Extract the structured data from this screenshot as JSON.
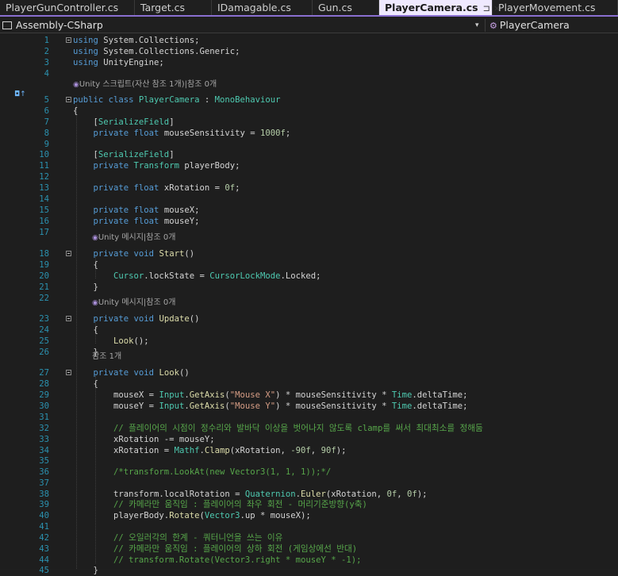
{
  "tabs": [
    {
      "label": "PlayerGunController.cs",
      "active": false
    },
    {
      "label": "Target.cs",
      "active": false
    },
    {
      "label": "IDamagable.cs",
      "active": false
    },
    {
      "label": "Gun.cs",
      "active": false
    },
    {
      "label": "PlayerCamera.cs",
      "active": true,
      "pin": "⊐",
      "close": "×"
    },
    {
      "label": "PlayerMovement.cs",
      "active": false
    }
  ],
  "nav": {
    "project": "Assembly-CSharp",
    "class": "PlayerCamera",
    "dropdown_glyph": "▾"
  },
  "lenses": {
    "class": "Unity 스크립트(자산 참조 1개)|참조 0개",
    "start": "Unity 메시지|참조 0개",
    "update": "Unity 메시지|참조 0개",
    "look": "참조 1개"
  },
  "lines": [
    {
      "n": "1",
      "tokens": [
        [
          "kw",
          "using"
        ],
        [
          "pl",
          " System.Collections;"
        ]
      ]
    },
    {
      "n": "2",
      "tokens": [
        [
          "kw",
          "using"
        ],
        [
          "pl",
          " System.Collections.Generic;"
        ]
      ]
    },
    {
      "n": "3",
      "tokens": [
        [
          "kw",
          "using"
        ],
        [
          "pl",
          " UnityEngine;"
        ]
      ]
    },
    {
      "n": "4",
      "tokens": []
    },
    {
      "n": "5",
      "tokens": [
        [
          "kw",
          "public class "
        ],
        [
          "ty",
          "PlayerCamera"
        ],
        [
          "pl",
          " : "
        ],
        [
          "ty",
          "MonoBehaviour"
        ]
      ]
    },
    {
      "n": "6",
      "tokens": [
        [
          "pl",
          "{"
        ]
      ]
    },
    {
      "n": "7",
      "tokens": [
        [
          "pl",
          "    ["
        ],
        [
          "ty",
          "SerializeField"
        ],
        [
          "pl",
          "]"
        ]
      ]
    },
    {
      "n": "8",
      "tokens": [
        [
          "kw",
          "    private float"
        ],
        [
          "pl",
          " mouseSensitivity = "
        ],
        [
          "nm",
          "1000f"
        ],
        [
          "pl",
          ";"
        ]
      ]
    },
    {
      "n": "9",
      "tokens": []
    },
    {
      "n": "10",
      "tokens": [
        [
          "pl",
          "    ["
        ],
        [
          "ty",
          "SerializeField"
        ],
        [
          "pl",
          "]"
        ]
      ]
    },
    {
      "n": "11",
      "tokens": [
        [
          "kw",
          "    private "
        ],
        [
          "ty",
          "Transform"
        ],
        [
          "pl",
          " playerBody;"
        ]
      ]
    },
    {
      "n": "12",
      "tokens": []
    },
    {
      "n": "13",
      "tokens": [
        [
          "kw",
          "    private float"
        ],
        [
          "pl",
          " xRotation = "
        ],
        [
          "nm",
          "0f"
        ],
        [
          "pl",
          ";"
        ]
      ]
    },
    {
      "n": "14",
      "tokens": []
    },
    {
      "n": "15",
      "tokens": [
        [
          "kw",
          "    private float"
        ],
        [
          "pl",
          " mouseX;"
        ]
      ]
    },
    {
      "n": "16",
      "tokens": [
        [
          "kw",
          "    private float"
        ],
        [
          "pl",
          " mouseY;"
        ]
      ]
    },
    {
      "n": "17",
      "tokens": []
    },
    {
      "n": "18",
      "tokens": [
        [
          "kw",
          "    private void "
        ],
        [
          "fn",
          "Start"
        ],
        [
          "pl",
          "()"
        ]
      ]
    },
    {
      "n": "19",
      "tokens": [
        [
          "pl",
          "    {"
        ]
      ]
    },
    {
      "n": "20",
      "tokens": [
        [
          "ty",
          "        Cursor"
        ],
        [
          "pl",
          ".lockState = "
        ],
        [
          "ty",
          "CursorLockMode"
        ],
        [
          "pl",
          ".Locked;"
        ]
      ]
    },
    {
      "n": "21",
      "tokens": [
        [
          "pl",
          "    }"
        ]
      ]
    },
    {
      "n": "22",
      "tokens": []
    },
    {
      "n": "23",
      "tokens": [
        [
          "kw",
          "    private void "
        ],
        [
          "fn",
          "Update"
        ],
        [
          "pl",
          "()"
        ]
      ]
    },
    {
      "n": "24",
      "tokens": [
        [
          "pl",
          "    {"
        ]
      ]
    },
    {
      "n": "25",
      "tokens": [
        [
          "fn",
          "        Look"
        ],
        [
          "pl",
          "();"
        ]
      ]
    },
    {
      "n": "26",
      "tokens": [
        [
          "pl",
          "    }"
        ]
      ]
    },
    {
      "n": "27",
      "tokens": [
        [
          "kw",
          "    private void "
        ],
        [
          "fn",
          "Look"
        ],
        [
          "pl",
          "()"
        ]
      ]
    },
    {
      "n": "28",
      "tokens": [
        [
          "pl",
          "    {"
        ]
      ]
    },
    {
      "n": "29",
      "tokens": [
        [
          "pl",
          "        mouseX = "
        ],
        [
          "ty",
          "Input"
        ],
        [
          "pl",
          "."
        ],
        [
          "fn",
          "GetAxis"
        ],
        [
          "pl",
          "("
        ],
        [
          "st",
          "\"Mouse X\""
        ],
        [
          "pl",
          ") * mouseSensitivity * "
        ],
        [
          "ty",
          "Time"
        ],
        [
          "pl",
          ".deltaTime;"
        ]
      ]
    },
    {
      "n": "30",
      "tokens": [
        [
          "pl",
          "        mouseY = "
        ],
        [
          "ty",
          "Input"
        ],
        [
          "pl",
          "."
        ],
        [
          "fn",
          "GetAxis"
        ],
        [
          "pl",
          "("
        ],
        [
          "st",
          "\"Mouse Y\""
        ],
        [
          "pl",
          ") * mouseSensitivity * "
        ],
        [
          "ty",
          "Time"
        ],
        [
          "pl",
          ".deltaTime;"
        ]
      ]
    },
    {
      "n": "31",
      "tokens": []
    },
    {
      "n": "32",
      "tokens": [
        [
          "cm",
          "        // 플레이어의 시점이 정수리와 발바닥 이상을 벗어나지 않도록 clamp를 써서 최대최소를 정해둠"
        ]
      ]
    },
    {
      "n": "33",
      "tokens": [
        [
          "pl",
          "        xRotation -= mouseY;"
        ]
      ]
    },
    {
      "n": "34",
      "tokens": [
        [
          "pl",
          "        xRotation = "
        ],
        [
          "ty",
          "Mathf"
        ],
        [
          "pl",
          "."
        ],
        [
          "fn",
          "Clamp"
        ],
        [
          "pl",
          "(xRotation, "
        ],
        [
          "nm",
          "-90f"
        ],
        [
          "pl",
          ", "
        ],
        [
          "nm",
          "90f"
        ],
        [
          "pl",
          ");"
        ]
      ]
    },
    {
      "n": "35",
      "tokens": []
    },
    {
      "n": "36",
      "tokens": [
        [
          "cm",
          "        /*transform.LookAt(new Vector3(1, 1, 1));*/"
        ]
      ]
    },
    {
      "n": "37",
      "tokens": []
    },
    {
      "n": "38",
      "tokens": [
        [
          "pl",
          "        transform.localRotation = "
        ],
        [
          "ty",
          "Quaternion"
        ],
        [
          "pl",
          "."
        ],
        [
          "fn",
          "Euler"
        ],
        [
          "pl",
          "(xRotation, "
        ],
        [
          "nm",
          "0f"
        ],
        [
          "pl",
          ", "
        ],
        [
          "nm",
          "0f"
        ],
        [
          "pl",
          ");"
        ]
      ]
    },
    {
      "n": "39",
      "tokens": [
        [
          "cm",
          "        // 카메라만 움직임 : 플레이어의 좌우 회전 - 머리기준방향(y축)"
        ]
      ]
    },
    {
      "n": "40",
      "tokens": [
        [
          "pl",
          "        playerBody."
        ],
        [
          "fn",
          "Rotate"
        ],
        [
          "pl",
          "("
        ],
        [
          "ty",
          "Vector3"
        ],
        [
          "pl",
          ".up * mouseX);"
        ]
      ]
    },
    {
      "n": "41",
      "tokens": []
    },
    {
      "n": "42",
      "tokens": [
        [
          "cm",
          "        // 오일러각의 한계 - 쿼터니언을 쓰는 이유"
        ]
      ]
    },
    {
      "n": "43",
      "tokens": [
        [
          "cm",
          "        // 카메라만 움직임 : 플레이어의 상하 회전 (게임상에선 반대)"
        ]
      ]
    },
    {
      "n": "44",
      "tokens": [
        [
          "cm",
          "        // transform.Rotate(Vector3.right * mouseY * -1);"
        ]
      ]
    },
    {
      "n": "45",
      "tokens": [
        [
          "pl",
          "    }"
        ]
      ]
    }
  ]
}
